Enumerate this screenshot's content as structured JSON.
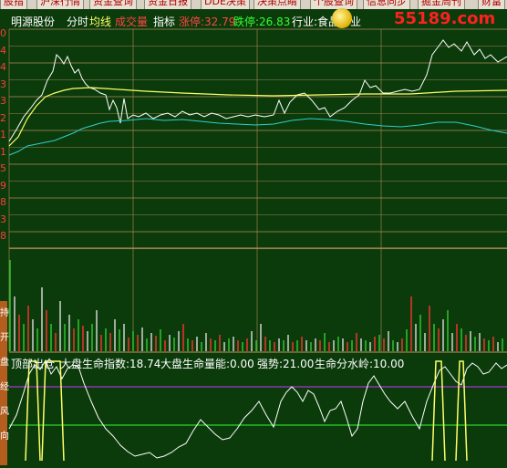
{
  "toolbar": {
    "buttons": [
      "股指",
      "沪深行情",
      "资金查询",
      "资金日报",
      "DDE决策",
      "决策点睛",
      "个股查询",
      "信息同步",
      "掘金周刊",
      "财富"
    ]
  },
  "header": {
    "stock_name": "明源股份",
    "tab_fenshi": "分时",
    "tab_junxian": "均线",
    "tab_chengjiao": "成交量",
    "tab_zhibiao": "指标",
    "limit_up_label": "涨停:32.79",
    "limit_down_label": "跌停:26.83",
    "industry_label": "行业:食品行业"
  },
  "watermark": "55189.com",
  "left_axis_ticks": [
    "0",
    "4",
    "4",
    "3",
    "3",
    "2",
    "1",
    "1",
    "5",
    "9",
    "8",
    "3",
    "8"
  ],
  "side_tabs": [
    "持",
    "开",
    "盘",
    "经",
    "风",
    "向"
  ],
  "indicator": {
    "name": "顶部出仓",
    "index_label": "大盘生命指数:18.74",
    "energy_label": "大盘生命量能:0.00",
    "strength_label": "强势:21.00",
    "water_label": "生命分水岭:10.00"
  },
  "colors": {
    "price_line": "#ffffff",
    "avg_line": "#ffff66",
    "ma_line": "#33cccc",
    "grid": "#c09060",
    "volume_up": "#ff3333",
    "volume_down": "#33cc33",
    "magenta_line": "#cc33ff",
    "green_line": "#33ff33"
  }
}
